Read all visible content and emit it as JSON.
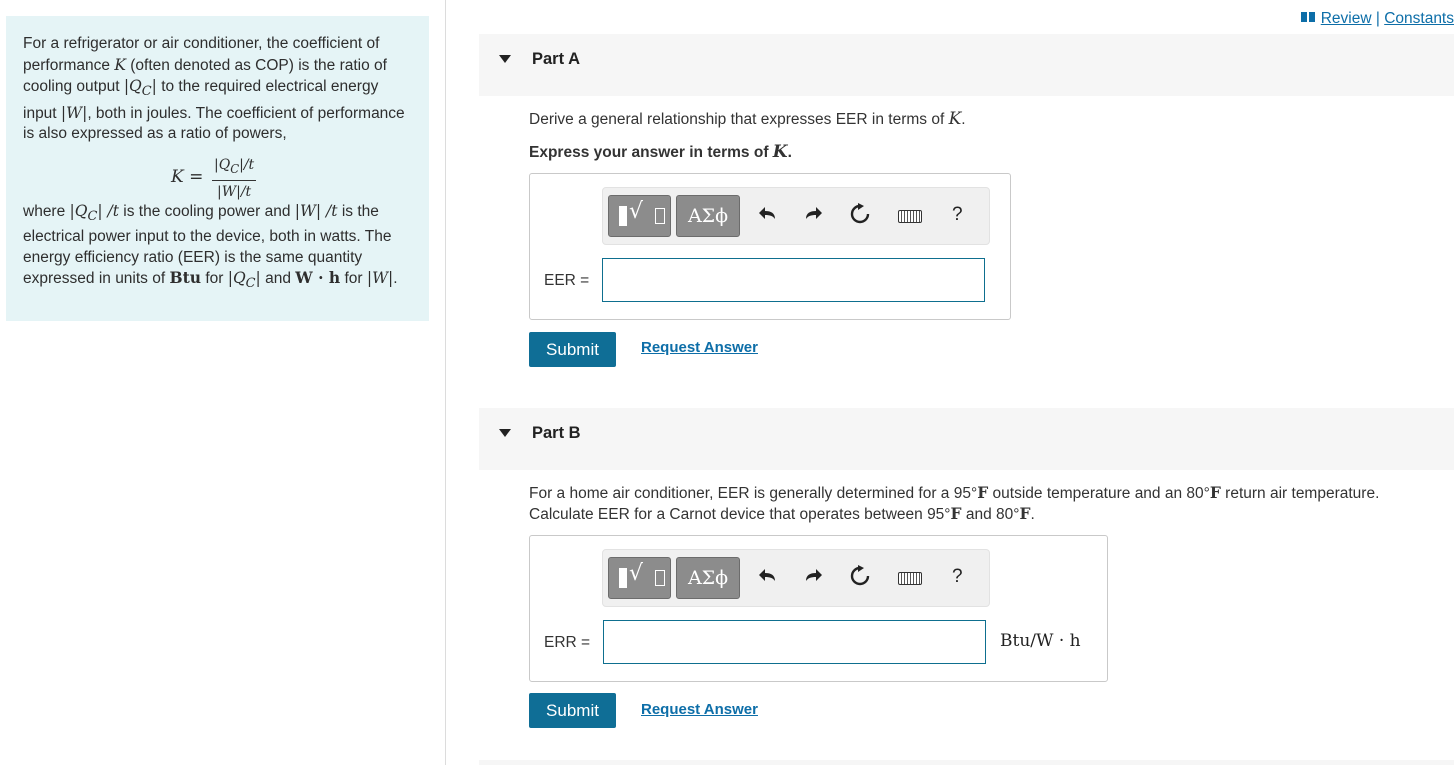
{
  "intro": {
    "p1_a": "For a refrigerator or air conditioner, the coefficient of performance ",
    "p1_K": "K",
    "p1_b": " (often denoted as COP) is the ratio of cooling output ",
    "p1_Qc": "|Q",
    "p1_Qc_sub": "C",
    "p1_Qc_end": "|",
    "p1_c": " to the required electrical energy input ",
    "p1_W": "|W|",
    "p1_d": ", both in joules. The coefficient of performance is also expressed as a ratio of powers,",
    "formula_lhs": "K =",
    "formula_num": "|Q",
    "formula_num_sub": "C",
    "formula_num_end": "|/t",
    "formula_den": "|W|/t",
    "p2_a": "where ",
    "p2_m1": "|Q",
    "p2_m1_sub": "C",
    "p2_m1_end": "| /t",
    "p2_b": " is the cooling power and ",
    "p2_m2": "|W| /t",
    "p2_c": " is the electrical power input to the device, both in watts. The energy efficiency ratio (EER) is the same quantity expressed in units of ",
    "p2_btu": "Btu",
    "p2_d": " for ",
    "p2_m3": "|Q",
    "p2_m3_sub": "C",
    "p2_m3_end": "|",
    "p2_e": " and ",
    "p2_wh": "W · h",
    "p2_f": " for ",
    "p2_m4": "|W|",
    "p2_g": "."
  },
  "toplinks": {
    "review": "Review",
    "sep": " | ",
    "constants": "Constants"
  },
  "partA": {
    "title": "Part A",
    "question_a": "Derive a general relationship that expresses EER in terms of ",
    "question_K": "K",
    "question_end": ".",
    "instruction_a": "Express your answer in terms of ",
    "instruction_K": "K",
    "instruction_end": ".",
    "greek_label": "ΑΣϕ",
    "help_label": "?",
    "answer_label": "EER =",
    "answer_value": "",
    "submit_label": "Submit",
    "request_label": "Request Answer"
  },
  "partB": {
    "title": "Part B",
    "line1_a": "For a home air conditioner, EER is generally determined for a ",
    "line1_t1": "95°",
    "line1_F1": "F",
    "line1_b": " outside temperature and an ",
    "line1_t2": "80°",
    "line1_F2": "F",
    "line1_c": " return air temperature.",
    "line2_a": "Calculate EER for a Carnot device that operates between ",
    "line2_t1": "95°",
    "line2_F1": "F",
    "line2_b": " and ",
    "line2_t2": "80°",
    "line2_F2": "F",
    "line2_c": ".",
    "greek_label": "ΑΣϕ",
    "help_label": "?",
    "answer_label": "ERR =",
    "answer_value": "",
    "units": "Btu/W · h",
    "submit_label": "Submit",
    "request_label": "Request Answer"
  },
  "colors": {
    "intro_bg": "#e5f4f6",
    "accent": "#0f6e96",
    "link": "#0d6ea8",
    "part_header_bg": "#f6f6f6"
  },
  "icons": [
    "book-icon",
    "template-icon",
    "greek-icon",
    "undo-icon",
    "redo-icon",
    "reset-icon",
    "keyboard-icon",
    "help-icon"
  ]
}
